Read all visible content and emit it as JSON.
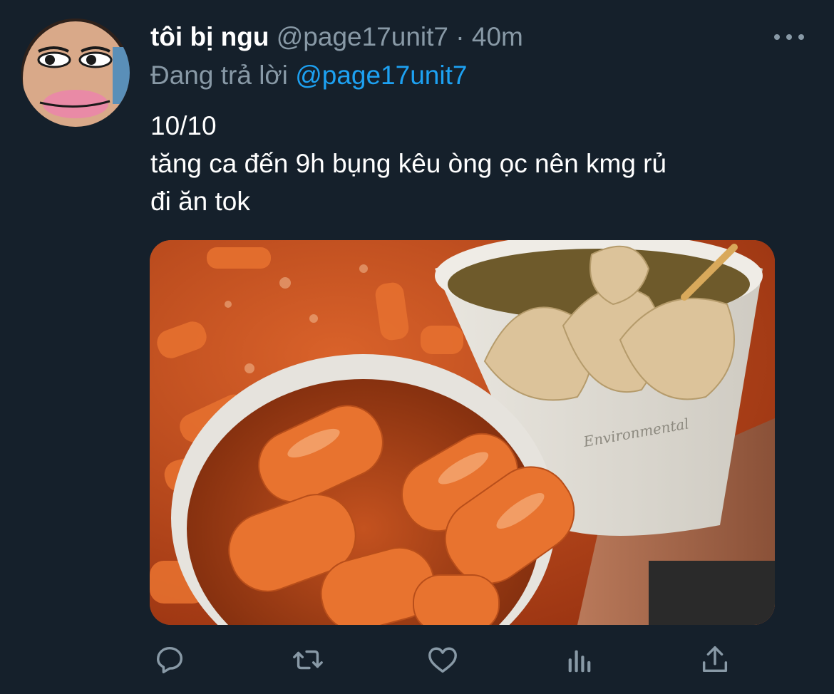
{
  "tweet": {
    "author_name": "tôi bị ngu",
    "author_handle": "@page17unit7",
    "separator": "·",
    "time": "40m",
    "replying_prefix": "Đang trả lời",
    "replying_to": "@page17unit7",
    "text_lines": [
      "10/10",
      "tăng ca đến 9h bụng kêu òng ọc nên kmg rủ",
      "đi ăn tok"
    ],
    "media_cup_text": "Environmental"
  },
  "icons": {
    "reply": "reply-icon",
    "retweet": "retweet-icon",
    "like": "heart-icon",
    "analytics": "analytics-icon",
    "share": "share-icon",
    "more": "more-horizontal-icon"
  },
  "colors": {
    "background": "#15202b",
    "secondary_text": "#8899a6",
    "accent": "#1da1f2",
    "primary_text": "#ffffff"
  }
}
